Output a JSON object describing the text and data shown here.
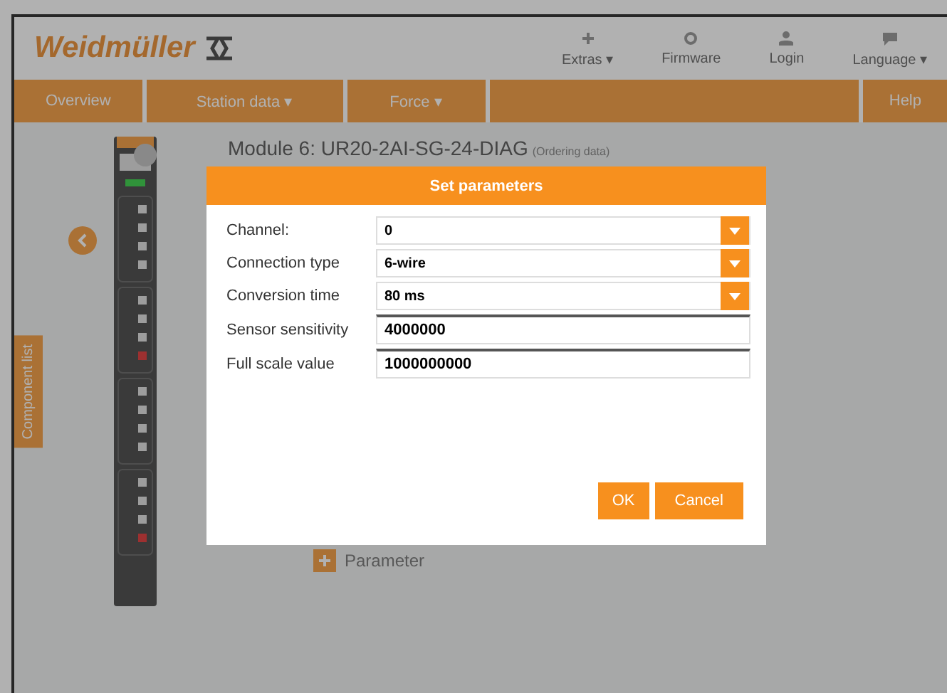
{
  "header": {
    "logo": "Weidmüller",
    "menu": [
      {
        "label": "Extras ▾"
      },
      {
        "label": "Firmware"
      },
      {
        "label": "Login"
      },
      {
        "label": "Language ▾"
      }
    ]
  },
  "nav": {
    "items": [
      {
        "label": "Overview"
      },
      {
        "label": "Station data ▾"
      },
      {
        "label": "Force ▾"
      }
    ],
    "help": "Help"
  },
  "side_tab": "Component list",
  "module": {
    "title": "Module 6: UR20-2AI-SG-24-DIAG",
    "link": "(Ordering data)",
    "parameter": "Parameter"
  },
  "dialog": {
    "title": "Set parameters",
    "fields": [
      {
        "kind": "select",
        "label": "Channel:",
        "value": "0"
      },
      {
        "kind": "select",
        "label": "Connection type",
        "value": "6-wire"
      },
      {
        "kind": "select",
        "label": "Conversion time",
        "value": "80 ms"
      },
      {
        "kind": "input",
        "label": "Sensor sensitivity",
        "value": "4000000"
      },
      {
        "kind": "input",
        "label": "Full scale value",
        "value": "1000000000"
      }
    ],
    "buttons": [
      "OK",
      "Cancel"
    ]
  }
}
